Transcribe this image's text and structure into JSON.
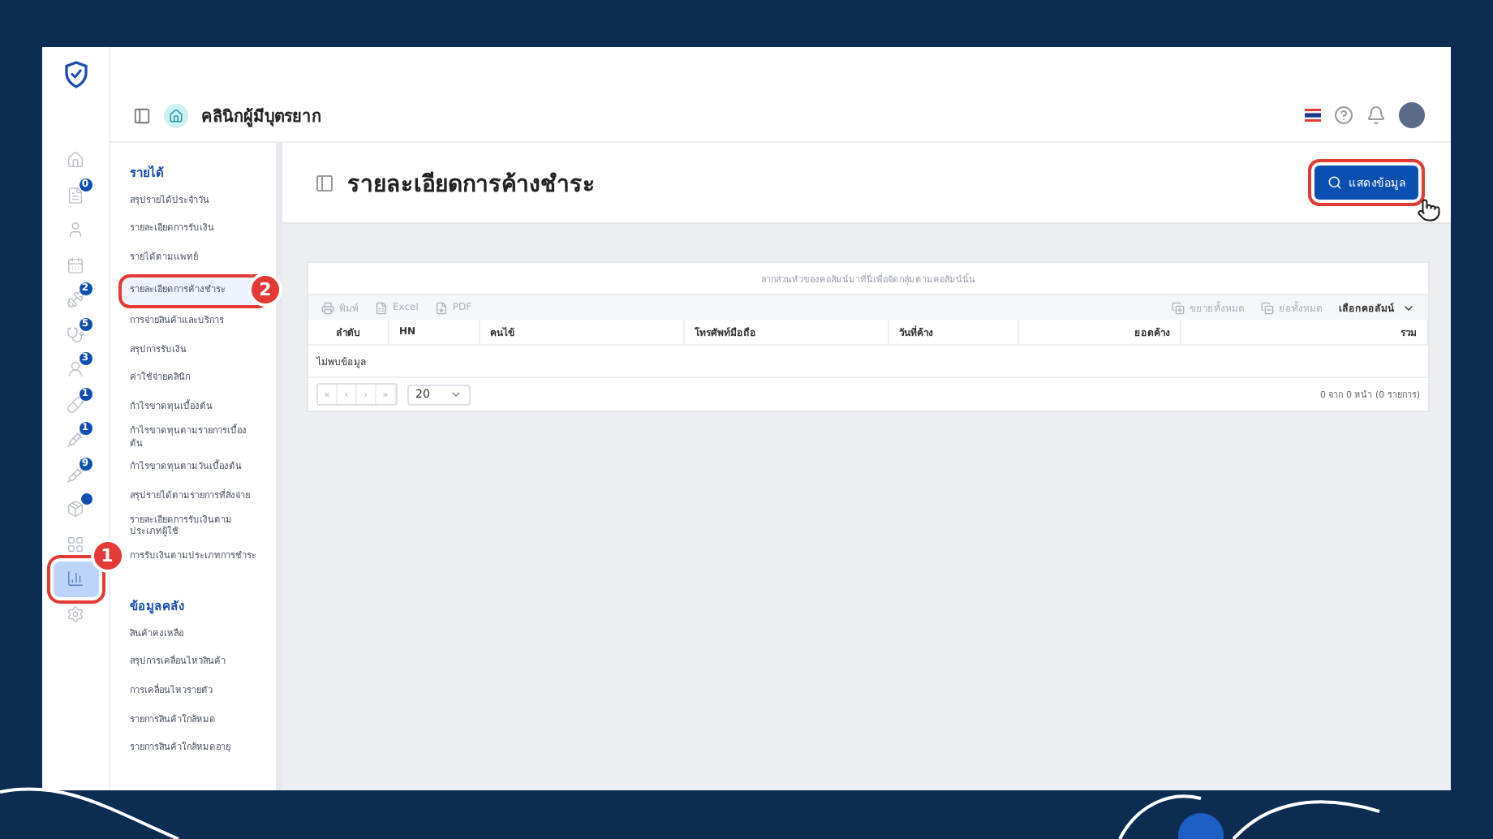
{
  "header": {
    "clinic_name": "คลินิกผู้มีบุตรยาก"
  },
  "rail": [
    {
      "kind": "plain",
      "selected": false
    },
    {
      "kind": "count",
      "badge": "0",
      "selected": false
    },
    {
      "kind": "plain",
      "selected": false
    },
    {
      "kind": "plain",
      "selected": false
    },
    {
      "kind": "count",
      "badge": "2",
      "selected": false
    },
    {
      "kind": "count",
      "badge": "5",
      "selected": false
    },
    {
      "kind": "count",
      "badge": "3",
      "selected": false
    },
    {
      "kind": "count",
      "badge": "1",
      "selected": false
    },
    {
      "kind": "count",
      "badge": "1",
      "selected": false
    },
    {
      "kind": "count",
      "badge": "9",
      "selected": false
    },
    {
      "kind": "dot",
      "selected": false
    },
    {
      "kind": "plain",
      "selected": false
    },
    {
      "kind": "plain",
      "selected": true,
      "callout": "1"
    },
    {
      "kind": "plain",
      "selected": false
    }
  ],
  "submenu": [
    {
      "title": "รายได้",
      "items": [
        {
          "label": "สรุปรายได้ประจำวัน",
          "selected": false
        },
        {
          "label": "รายละเอียดการรับเงิน",
          "selected": false
        },
        {
          "label": "รายได้ตามแพทย์",
          "selected": false
        },
        {
          "label": "รายละเอียดการค้างชำระ",
          "selected": true,
          "callout": "2"
        },
        {
          "label": "การจ่ายสินค้าและบริการ",
          "selected": false
        },
        {
          "label": "สรุปการรับเงิน",
          "selected": false
        },
        {
          "label": "ค่าใช้จ่ายคลินิก",
          "selected": false
        },
        {
          "label": "กำไรขาดทุนเบื้องต้น",
          "selected": false
        },
        {
          "label": "กำไรขาดทุนตามรายการเบื้องต้น",
          "selected": false
        },
        {
          "label": "กำไรขาดทุนตามวันเบื้องต้น",
          "selected": false
        },
        {
          "label": "สรุปรายได้ตามรายการที่สั่งจ่าย",
          "selected": false
        },
        {
          "label": "รายละเอียดการรับเงินตามประเภทผู้ใช้",
          "selected": false
        },
        {
          "label": "การรับเงินตามประเภทการชำระ",
          "selected": false
        }
      ]
    },
    {
      "title": "ข้อมูลคลัง",
      "items": [
        {
          "label": "สินค้าคงเหลือ",
          "selected": false
        },
        {
          "label": "สรุปการเคลื่อนไหวสินค้า",
          "selected": false
        },
        {
          "label": "การเคลื่อนไหวรายตัว",
          "selected": false
        },
        {
          "label": "รายการสินค้าใกล้หมด",
          "selected": false
        },
        {
          "label": "รายการสินค้าใกล้หมดอายุ",
          "selected": false
        }
      ]
    }
  ],
  "page": {
    "title": "รายละเอียดการค้างชำระ",
    "show_button": "แสดงข้อมูล"
  },
  "grid": {
    "group_hint": "ลากส่วนหัวของคอลัมน์มาที่นี่เพื่อจัดกลุ่มตามคอลัมน์นั้น",
    "tools_left": [
      "พิมพ์",
      "Excel",
      "PDF"
    ],
    "tools_right": [
      "ขยายทั้งหมด",
      "ย่อทั้งหมด"
    ],
    "column_chooser": "เลือกคอลัมน์",
    "columns": [
      "ลำดับ",
      "HN",
      "คนไข้",
      "โทรศัพท์มือถือ",
      "วันที่ค้าง",
      "ยอดค้าง",
      "รวม"
    ],
    "empty": "ไม่พบข้อมูล",
    "pager": [
      "«",
      "‹",
      "›",
      "»"
    ],
    "page_size": "20",
    "info": "0 จาก 0 หน้า (0 รายการ)"
  }
}
